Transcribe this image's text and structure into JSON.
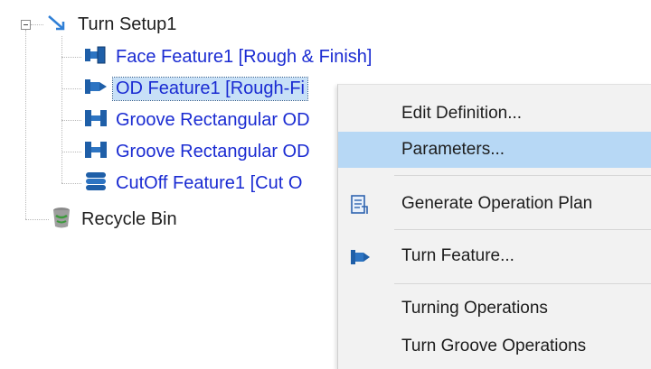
{
  "tree": {
    "root": {
      "label": "Turn Setup1",
      "icon": "turn-setup-icon"
    },
    "children": [
      {
        "label": "Face Feature1 [Rough & Finish]",
        "icon": "face-feature-icon"
      },
      {
        "label": "OD Feature1 [Rough-Fi",
        "icon": "od-feature-icon",
        "selected": true
      },
      {
        "label": "Groove Rectangular OD",
        "icon": "groove-feature-icon"
      },
      {
        "label": "Groove Rectangular OD",
        "icon": "groove-feature-icon"
      },
      {
        "label": "CutOff Feature1 [Cut O",
        "icon": "cutoff-feature-icon"
      }
    ],
    "recycle": {
      "label": "Recycle Bin",
      "icon": "recycle-bin-icon"
    }
  },
  "context_menu": {
    "items": [
      {
        "label": "Edit Definition...",
        "icon": ""
      },
      {
        "label": "Parameters...",
        "icon": "",
        "highlighted": true
      },
      {
        "label": "Generate Operation Plan",
        "icon": "operation-plan-icon"
      },
      {
        "label": "Turn Feature...",
        "icon": "turn-feature-icon"
      },
      {
        "label": "Turning Operations",
        "icon": ""
      },
      {
        "label": "Turn Groove Operations",
        "icon": ""
      }
    ]
  }
}
